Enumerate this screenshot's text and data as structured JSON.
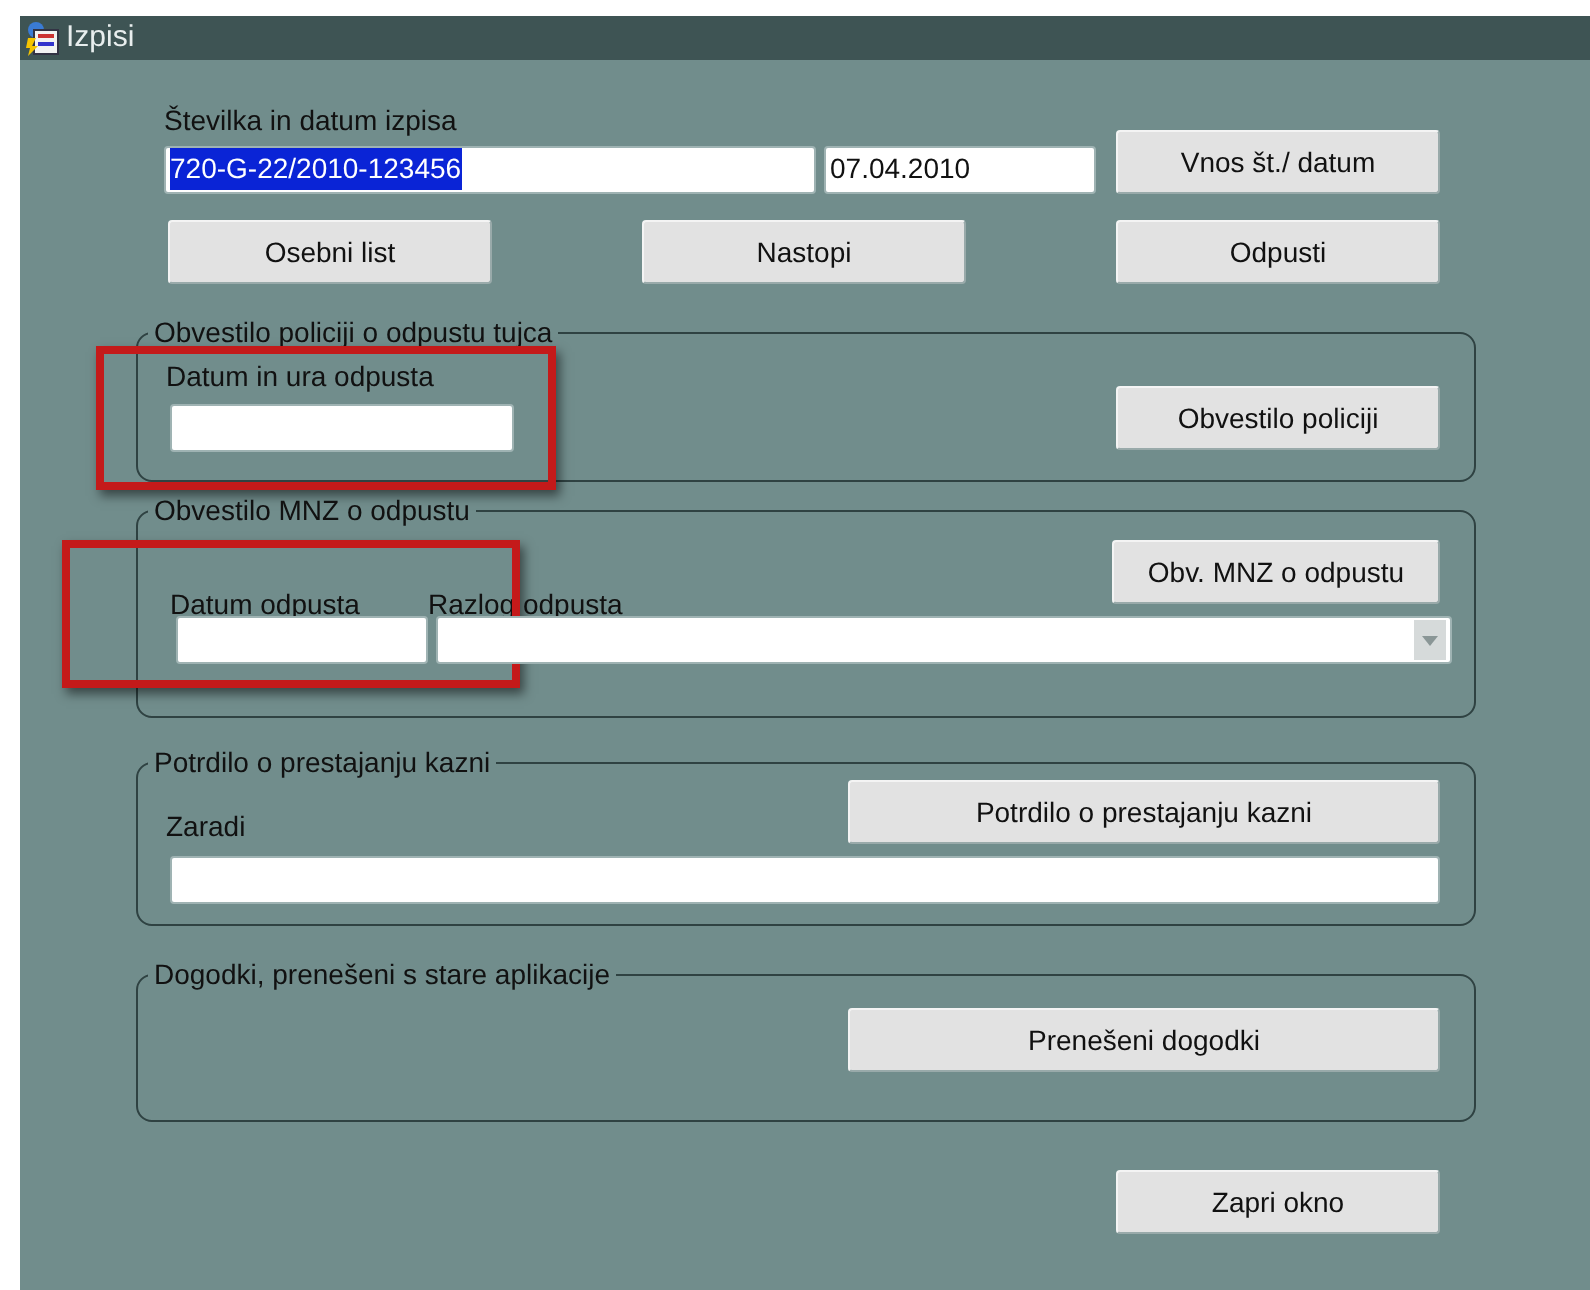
{
  "window": {
    "title": "Izpisi"
  },
  "header": {
    "label": "Številka in datum izpisa",
    "number": {
      "value": "720-G-22/2010-123456",
      "selected": true
    },
    "date": {
      "value": "07.04.2010"
    },
    "button": "Vnos št./ datum"
  },
  "top_buttons": [
    "Osebni list",
    "Nastopi",
    "Odpusti"
  ],
  "groups": [
    {
      "kind": "police",
      "legend": "Obvestilo policiji o odpustu tujca",
      "fields": [
        {
          "kind": "text",
          "label": "Datum in ura odpusta",
          "highlighted": true
        }
      ],
      "button": "Obvestilo policiji"
    },
    {
      "kind": "mnz",
      "legend": "Obvestilo MNZ o odpustu",
      "fields": [
        {
          "kind": "text",
          "label": "Datum odpusta",
          "highlighted": true
        },
        {
          "kind": "combo",
          "label": "Razlog odpusta",
          "highlighted": false
        }
      ],
      "button": "Obv. MNZ o odpustu"
    },
    {
      "kind": "certificate",
      "legend": "Potrdilo o prestajanju kazni",
      "fields": [
        {
          "kind": "text",
          "label": "Zaradi",
          "highlighted": false
        }
      ],
      "button": "Potrdilo o prestajanju kazni"
    },
    {
      "kind": "events",
      "legend": "Dogodki, prenešeni s stare aplikacije",
      "button": "Prenešeni dogodki"
    }
  ],
  "close_button": "Zapri okno"
}
